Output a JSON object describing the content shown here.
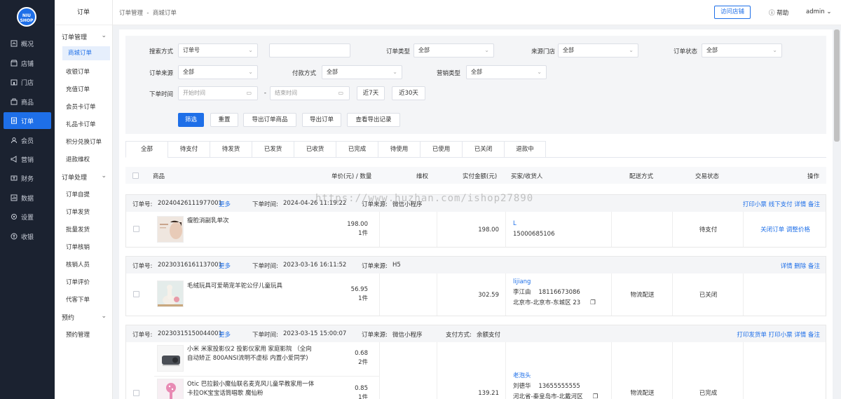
{
  "logo": {
    "line1": "NIU",
    "line2": "SHOP"
  },
  "nav": {
    "items": [
      {
        "label": "概况",
        "icon": "overview-icon"
      },
      {
        "label": "店铺",
        "icon": "store-icon"
      },
      {
        "label": "门店",
        "icon": "shop-icon"
      },
      {
        "label": "商品",
        "icon": "goods-icon"
      },
      {
        "label": "订单",
        "icon": "order-icon",
        "active": true
      },
      {
        "label": "会员",
        "icon": "member-icon"
      },
      {
        "label": "营销",
        "icon": "marketing-icon"
      },
      {
        "label": "财务",
        "icon": "finance-icon"
      },
      {
        "label": "数据",
        "icon": "data-icon"
      },
      {
        "label": "设置",
        "icon": "settings-icon"
      },
      {
        "label": "收银",
        "icon": "cashier-icon"
      }
    ]
  },
  "subnav": {
    "title": "订单",
    "groups": [
      {
        "label": "订单管理",
        "items": [
          "商城订单",
          "收银订单",
          "充值订单",
          "会员卡订单",
          "礼品卡订单",
          "积分兑换订单",
          "退款维权"
        ]
      },
      {
        "label": "订单处理",
        "items": [
          "订单自提",
          "订单发货",
          "批量发货",
          "订单核销",
          "核销人员",
          "订单评价",
          "代客下单"
        ]
      },
      {
        "label": "预约",
        "items": [
          "预约管理"
        ]
      }
    ]
  },
  "header": {
    "breadcrumb_1": "订单管理",
    "breadcrumb_sep": "-",
    "breadcrumb_2": "商城订单",
    "visit_store": "访问店铺",
    "help": "帮助",
    "user": "admin"
  },
  "filter": {
    "search_label": "搜索方式",
    "search_value": "订单号",
    "search_input": "",
    "type_label": "订单类型",
    "type_value": "全部",
    "store_label": "来源门店",
    "store_value": "全部",
    "status_label": "订单状态",
    "status_value": "全部",
    "source_label": "订单来源",
    "source_value": "全部",
    "pay_label": "付款方式",
    "pay_value": "全部",
    "market_label": "营销类型",
    "market_value": "全部",
    "time_label": "下单时间",
    "time_start_ph": "开始时间",
    "time_sep": "-",
    "time_end_ph": "结束时间",
    "last7": "近7天",
    "last30": "近30天",
    "btn_filter": "筛选",
    "btn_reset": "重置",
    "btn_export_goods": "导出订单商品",
    "btn_export": "导出订单",
    "btn_export_log": "查看导出记录"
  },
  "tabs": [
    "全部",
    "待支付",
    "待发货",
    "已发货",
    "已收货",
    "已完成",
    "待使用",
    "已使用",
    "已关闭",
    "退款中"
  ],
  "table_head": {
    "goods": "商品",
    "price": "单价(元) / 数量",
    "rights": "维权",
    "paid": "实付金额(元)",
    "buyer": "买家/收货人",
    "ship": "配送方式",
    "status": "交易状态",
    "ops": "操作"
  },
  "orders": [
    {
      "no_label": "订单号:",
      "no": "20240426111977001",
      "more": "更多",
      "time_label": "下单时间:",
      "time": "2024-04-26 11:19:22",
      "src_label": "订单来源:",
      "src": "微信小程序",
      "acts": "打印小票 线下支付 详情 备注",
      "goods": [
        {
          "name": "瘦脸消副乳单次",
          "price": "198.00",
          "qty": "1件"
        }
      ],
      "paid": "198.00",
      "buyer_name": "L",
      "buyer_phone": "15000685106",
      "status": "待支付",
      "ops": "关闭订单 调整价格"
    },
    {
      "no_label": "订单号:",
      "no": "20230316161137001",
      "more": "更多",
      "time_label": "下单时间:",
      "time": "2023-03-16 16:11:52",
      "src_label": "订单来源:",
      "src": "H5",
      "acts": "详情 删除 备注",
      "goods": [
        {
          "name": "毛绒玩具可爱萌宠羊驼公仔儿童玩具",
          "price": "56.95",
          "qty": "1件"
        }
      ],
      "paid": "302.59",
      "buyer_name": "lijiang",
      "receiver": "李江由",
      "receiver_phone": "18116673086",
      "address": "北京市-北京市-东城区 23",
      "ship": "物流配送",
      "status": "已关闭"
    },
    {
      "no_label": "订单号:",
      "no": "20230315150044001",
      "more": "更多",
      "time_label": "下单时间:",
      "time": "2023-03-15 15:00:07",
      "src_label": "订单来源:",
      "src": "微信小程序",
      "pay_label": "支付方式:",
      "pay": "余额支付",
      "acts": "打印发货单 打印小票 详情 备注",
      "goods": [
        {
          "name1": "小米 米家投影仪2 投影仪家用 家庭影院 （全向",
          "name2": "自动矫正 800ANSI流明不虚标 内置小爱同学)",
          "price": "0.68",
          "qty": "2件"
        },
        {
          "name1": "Otic 巴拉毅小魔仙联名麦克风儿童早教家用一体",
          "name2": "卡拉OK宝宝话筒唱歌 魔仙粉",
          "price": "0.85",
          "qty": "1件"
        }
      ],
      "paid": "139.21",
      "buyer_name": "老泡头",
      "receiver": "刘德华",
      "receiver_phone": "13655555555",
      "address": "河北省-秦皇岛市-北戴河区",
      "ship": "物流配送",
      "status": "已完成"
    }
  ],
  "watermark": "https://www.huzhan.com/ishop27890"
}
